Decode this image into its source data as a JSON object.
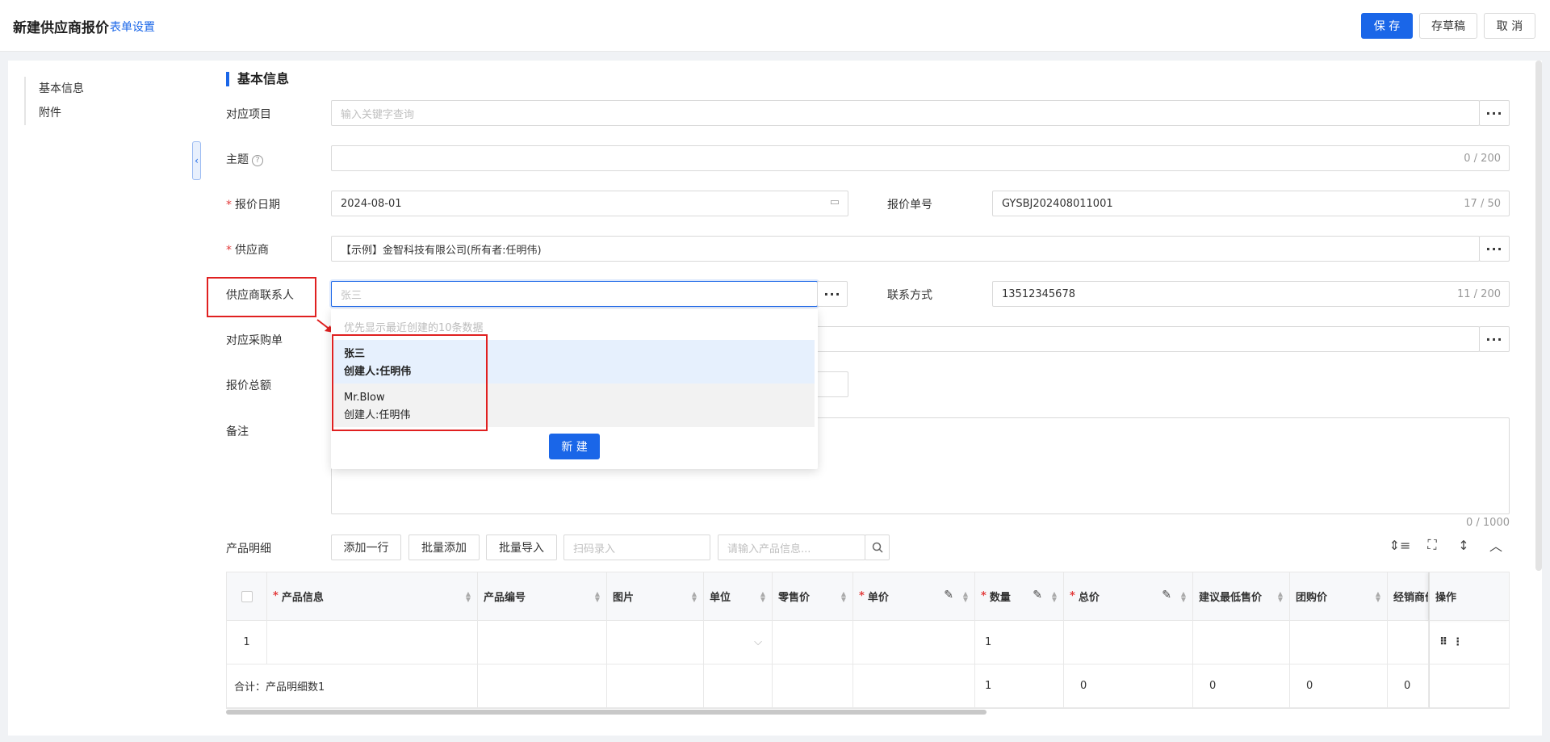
{
  "header": {
    "title": "新建供应商报价",
    "form_settings": "表单设置",
    "save": "保 存",
    "draft": "存草稿",
    "cancel": "取 消"
  },
  "left_nav": [
    "基本信息",
    "附件"
  ],
  "section_title": "基本信息",
  "fields": {
    "project": {
      "label": "对应项目",
      "placeholder": "输入关键字查询"
    },
    "subject": {
      "label": "主题",
      "value": "",
      "counter": "0 / 200"
    },
    "quote_date": {
      "label": "报价日期",
      "value": "2024-08-01",
      "required": true
    },
    "quote_no": {
      "label": "报价单号",
      "value": "GYSBJ202408011001",
      "counter": "17 / 50"
    },
    "supplier": {
      "label": "供应商",
      "value": "【示例】金智科技有限公司(所有者:任明伟)",
      "required": true
    },
    "supplier_contact": {
      "label": "供应商联系人",
      "placeholder": "张三"
    },
    "contact_info": {
      "label": "联系方式",
      "value": "13512345678",
      "counter": "11 / 200"
    },
    "purchase_order": {
      "label": "对应采购单"
    },
    "total_quote": {
      "label": "报价总额"
    },
    "remark": {
      "label": "备注",
      "counter": "0 / 1000"
    }
  },
  "dropdown": {
    "hint": "优先显示最近创建的10条数据",
    "items": [
      {
        "name": "张三",
        "creator": "创建人:任明伟"
      },
      {
        "name": "Mr.Blow",
        "creator": "创建人:任明伟"
      }
    ],
    "new_button": "新 建"
  },
  "products": {
    "label": "产品明细",
    "add_row": "添加一行",
    "batch_add": "批量添加",
    "batch_import": "批量导入",
    "scan_placeholder": "扫码录入",
    "search_placeholder": "请输入产品信息...",
    "columns": [
      "产品信息",
      "产品编号",
      "图片",
      "单位",
      "零售价",
      "单价",
      "数量",
      "总价",
      "建议最低售价",
      "团购价",
      "经销商价",
      "操作"
    ],
    "row": {
      "index": "1",
      "quantity": "1"
    },
    "summary": {
      "label": "合计：产品明细数1",
      "quantity": "1",
      "total": "0",
      "min_price": "0",
      "group_price": "0",
      "dealer_price": "0"
    }
  },
  "icons": [
    "calendar-icon",
    "help-icon",
    "search-icon",
    "row-height-icon",
    "fullscreen-icon",
    "resize-icon",
    "collapse-icon",
    "drag-icon",
    "more-icon",
    "chevron-down-icon",
    "edit-icon",
    "sort-icon"
  ],
  "colors": {
    "primary": "#1a66e8",
    "highlight": "#e02020",
    "selected_row": "#e6f0fd"
  }
}
